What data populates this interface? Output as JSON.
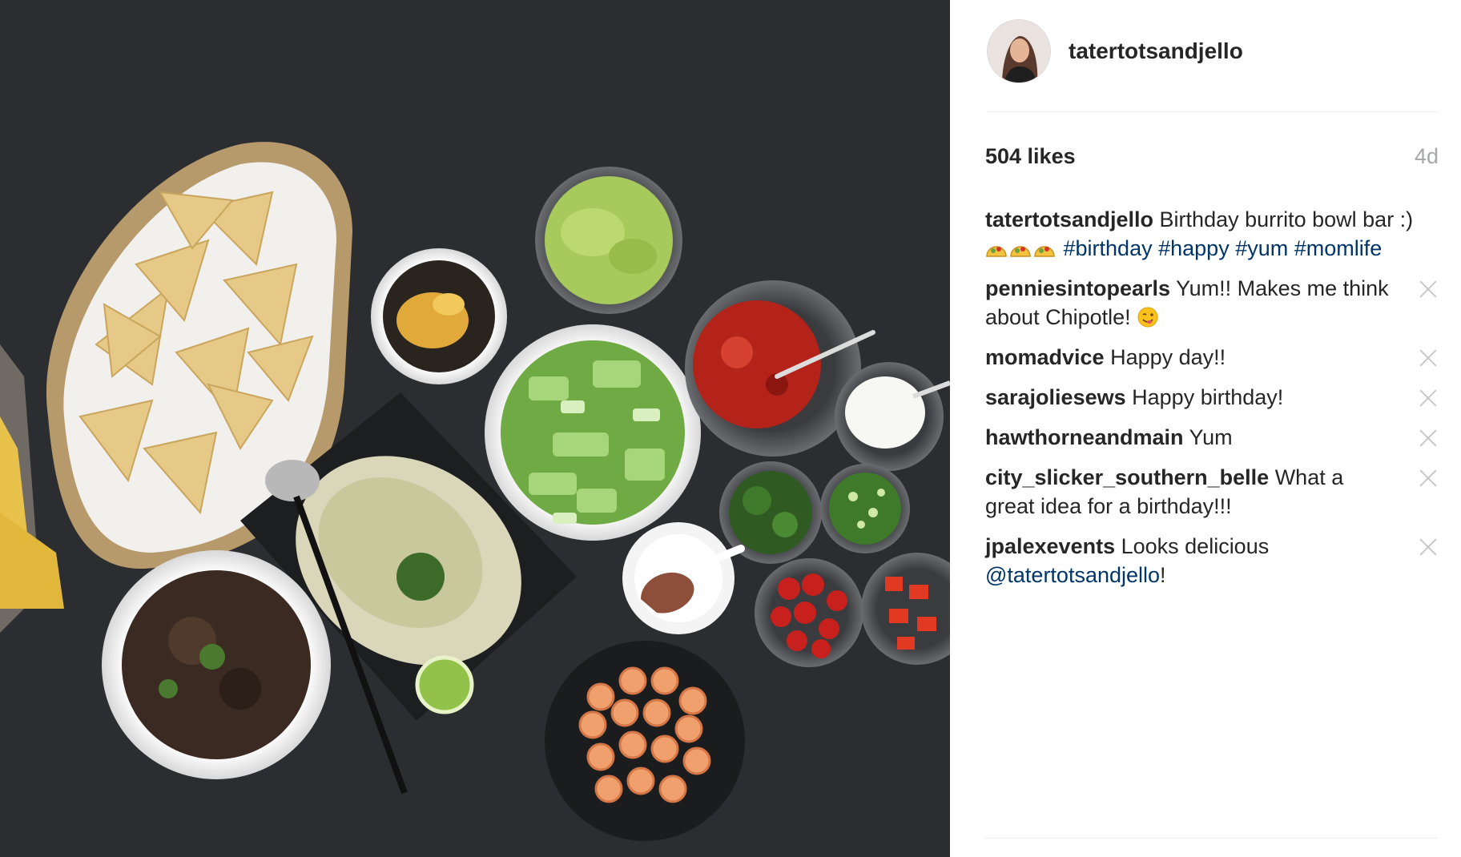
{
  "post": {
    "image_alt": "Birthday burrito bowl bar",
    "username": "tatertotsandjello",
    "likes": "504 likes",
    "age": "4d"
  },
  "caption": {
    "author": "tatertotsandjello",
    "text": "Birthday burrito bowl bar :) ",
    "emoji": "taco-emoji",
    "hashtags": [
      "#birthday",
      "#happy",
      "#yum",
      "#momlife"
    ]
  },
  "comments": [
    {
      "author": "penniesintopearls",
      "text": "Yum!! Makes me think about Chipotle! ",
      "emoji": "yum-face-emoji"
    },
    {
      "author": "momadvice",
      "text": "Happy day!!"
    },
    {
      "author": "sarajoliesews",
      "text": "Happy birthday!"
    },
    {
      "author": "hawthorneandmain",
      "text": "Yum"
    },
    {
      "author": "city_slicker_southern_belle",
      "text": "What a great idea for a birthday!!!"
    },
    {
      "author": "jpalexevents",
      "text": "Looks delicious ",
      "mention": "@tatertotsandjello",
      "suffix": "!"
    }
  ],
  "colors": {
    "hashtag": "#003569",
    "text": "#262626",
    "muted": "#a5a7aa",
    "photo_background": "#2c2d30"
  }
}
